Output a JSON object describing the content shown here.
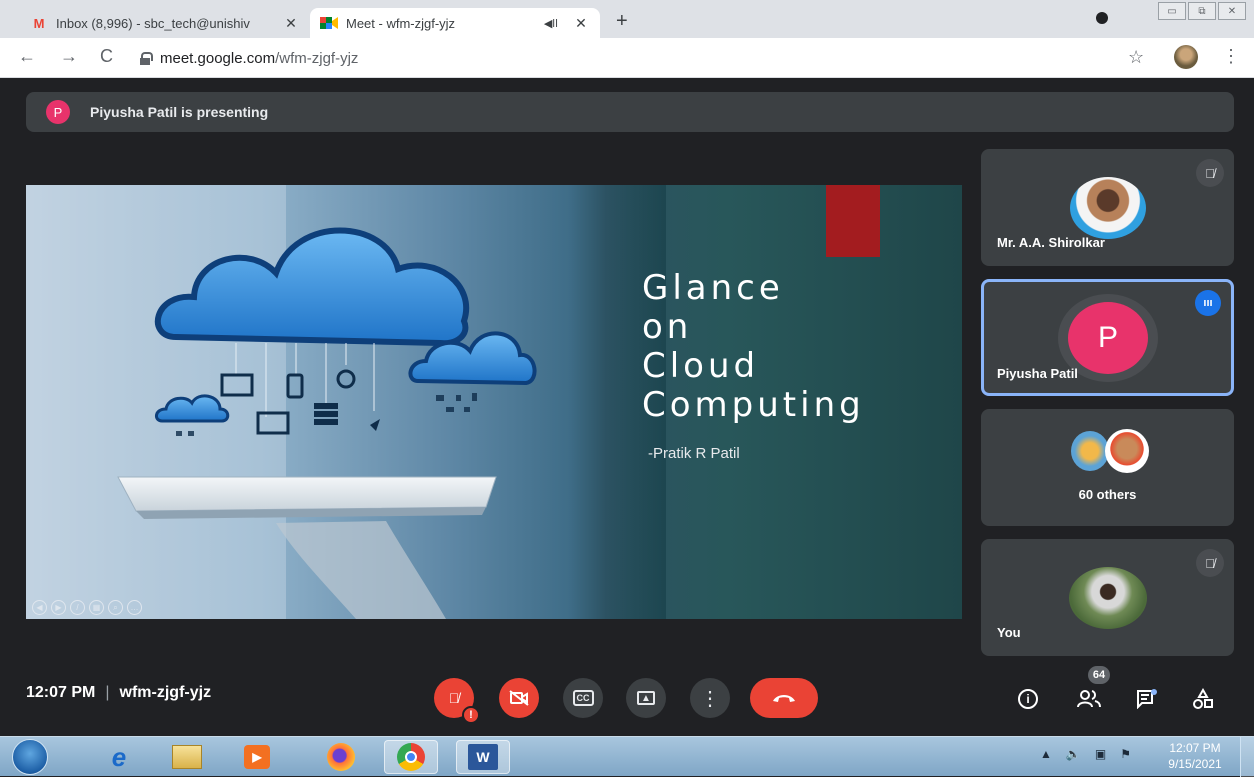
{
  "browser": {
    "tabs": [
      {
        "title": "Inbox (8,996) - sbc_tech@unishiv",
        "favicon": "gmail-icon",
        "active": false
      },
      {
        "title": "Meet - wfm-zjgf-yjz",
        "favicon": "meet-icon",
        "active": true
      }
    ],
    "url_domain": "meet.google.com",
    "url_path": "/wfm-zjgf-yjz"
  },
  "meet": {
    "presenting": {
      "avatar_letter": "P",
      "text": "Piyusha Patil is presenting"
    },
    "slide": {
      "title_lines": [
        "Glance",
        "on",
        "Cloud",
        "Computing"
      ],
      "author": "-Pratik R Patil"
    },
    "participants": [
      {
        "name": "Mr. A.A. Shirolkar",
        "muted": true
      },
      {
        "name": "Piyusha Patil",
        "avatar_letter": "P",
        "speaking": true
      },
      {
        "name": "60 others",
        "group": true
      },
      {
        "name": "You",
        "muted": true
      }
    ],
    "time": "12:07 PM",
    "sep": "|",
    "meeting_code": "wfm-zjgf-yjz",
    "people_count": "64",
    "warn": "!"
  },
  "taskbar": {
    "clock_time": "12:07 PM",
    "clock_date": "9/15/2021",
    "word_label": "W"
  },
  "colors": {
    "meet_bg": "#202124",
    "tile_bg": "#3c4043",
    "danger": "#ea4335",
    "presenter_pink": "#e8336b",
    "speaker_blue": "#1a73e8"
  }
}
